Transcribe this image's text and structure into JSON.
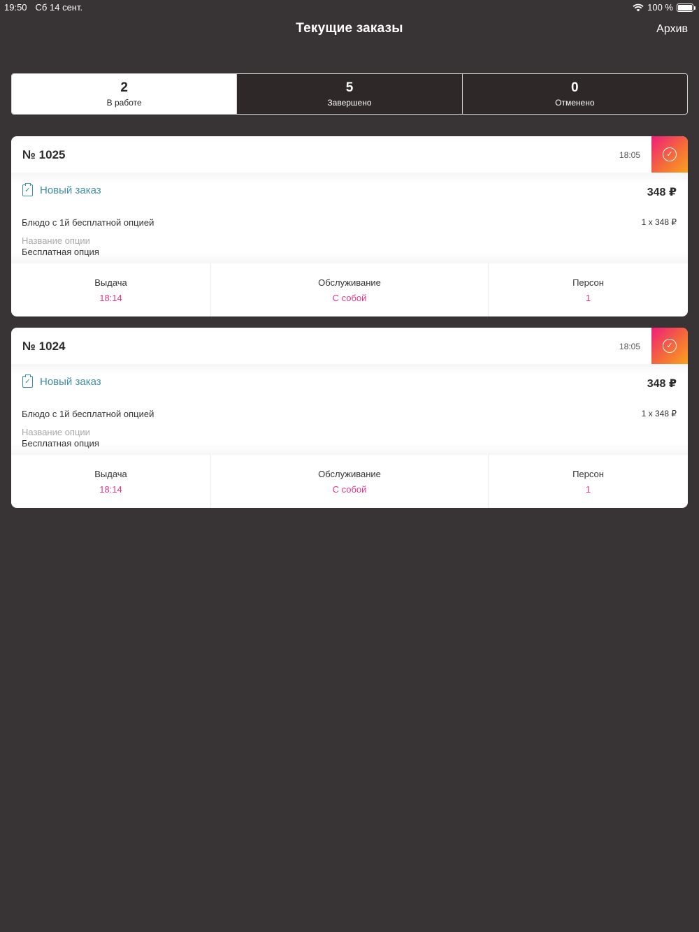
{
  "status_bar": {
    "time": "19:50",
    "date": "Сб 14 сент.",
    "battery": "100 %"
  },
  "nav": {
    "title": "Текущие заказы",
    "archive": "Архив"
  },
  "segments": [
    {
      "count": "2",
      "label": "В работе"
    },
    {
      "count": "5",
      "label": "Завершено"
    },
    {
      "count": "0",
      "label": "Отменено"
    }
  ],
  "orders": [
    {
      "number": "№ 1025",
      "time": "18:05",
      "status": "Новый заказ",
      "total": "348 ₽",
      "item_name": "Блюдо с 1й бесплатной опцией",
      "item_qty": "1 x 348 ₽",
      "option_label": "Название опции",
      "option_value": "Бесплатная опция",
      "pickup_label": "Выдача",
      "pickup_value": "18:14",
      "service_label": "Обслуживание",
      "service_value": "С собой",
      "persons_label": "Персон",
      "persons_value": "1"
    },
    {
      "number": "№ 1024",
      "time": "18:05",
      "status": "Новый заказ",
      "total": "348 ₽",
      "item_name": "Блюдо с 1й бесплатной опцией",
      "item_qty": "1 x 348 ₽",
      "option_label": "Название опции",
      "option_value": "Бесплатная опция",
      "pickup_label": "Выдача",
      "pickup_value": "18:14",
      "service_label": "Обслуживание",
      "service_value": "С собой",
      "persons_label": "Персон",
      "persons_value": "1"
    }
  ],
  "colors": {
    "background": "#383334",
    "accent_pink": "#e0368d",
    "status_teal": "#3f8fa6"
  },
  "icons": {
    "status": "clipboard-check-icon",
    "confirm": "check-circle-icon",
    "wifi": "wifi-icon",
    "battery": "battery-icon"
  }
}
